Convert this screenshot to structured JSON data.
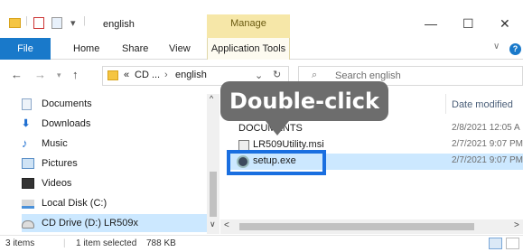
{
  "title_bar": {
    "folder_name": "english",
    "manage_label": "Manage",
    "minimize": "—",
    "maximize": "☐",
    "close": "✕"
  },
  "ribbon": {
    "tabs": [
      "File",
      "Home",
      "Share",
      "View"
    ],
    "app_tools": "Application Tools"
  },
  "address": {
    "path_prefix": "«",
    "path_part1": "CD ...",
    "sep": "›",
    "path_part2": "english",
    "search_placeholder": "Search english"
  },
  "nav": {
    "items": [
      {
        "label": "Documents",
        "icon": "documents-icon",
        "color": "#8aa6c8"
      },
      {
        "label": "Downloads",
        "icon": "download-arrow-icon",
        "color": "#1f6fd1"
      },
      {
        "label": "Music",
        "icon": "music-note-icon",
        "color": "#1f6fd1"
      },
      {
        "label": "Pictures",
        "icon": "pictures-icon",
        "color": "#5a8fc7"
      },
      {
        "label": "Videos",
        "icon": "videos-icon",
        "color": "#333"
      },
      {
        "label": "Local Disk (C:)",
        "icon": "local-disk-icon",
        "color": "#4a90d9"
      },
      {
        "label": "CD Drive (D:) LR509x",
        "icon": "cd-drive-icon",
        "color": "#777"
      }
    ]
  },
  "files": {
    "date_header": "Date modified",
    "rows": [
      {
        "name": "DOCUMENTS",
        "date": "2/8/2021 12:05 A"
      },
      {
        "name": "LR509Utility.msi",
        "date": "2/7/2021 9:07 PM"
      },
      {
        "name": "setup.exe",
        "date": "2/7/2021 9:07 PM"
      }
    ]
  },
  "callout": {
    "text": "Double-click"
  },
  "status": {
    "items": "3 items",
    "selected": "1 item selected",
    "size": "788 KB"
  },
  "colors": {
    "accent": "#1979ca",
    "selection": "#cce8ff",
    "highlight_box": "#1a6fe0",
    "callout": "#6d6d6d"
  }
}
